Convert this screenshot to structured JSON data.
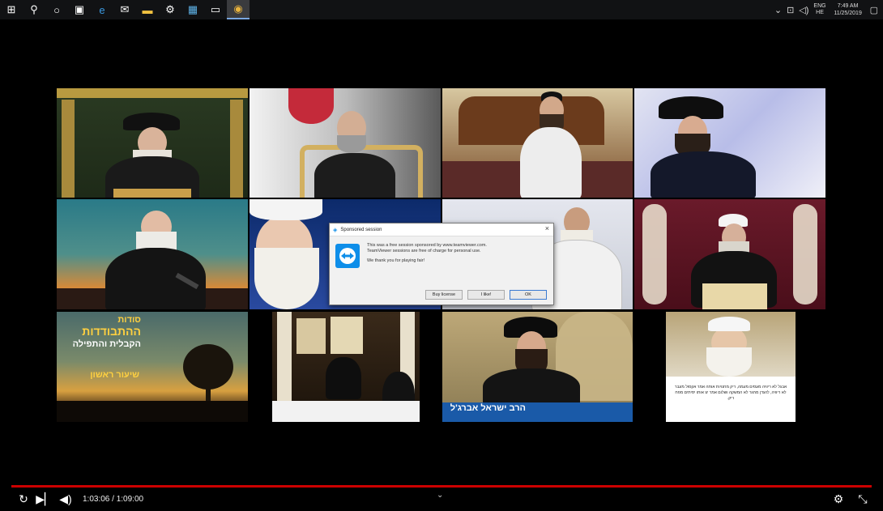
{
  "taskbar": {
    "icons": [
      "windows-start-icon",
      "search-icon",
      "cortana-icon",
      "store-icon",
      "edge-icon",
      "mail-icon",
      "file-explorer-icon",
      "app-icon",
      "photos-icon",
      "terminal-icon",
      "chrome-icon"
    ],
    "lang_line1": "ENG",
    "lang_line2": "HE",
    "time": "7:49 AM",
    "date": "11/25/2019"
  },
  "tiles": {
    "t9_line1": "סודות",
    "t9_line2": "ההתבודדות",
    "t9_line3": "הקבלית והתפילה",
    "t9_line4": "שיעור ראשון",
    "t11_caption": "הרב ישראל אברג'ל",
    "t12_caption": "אבגל לא ריוויה מעסים מעמה, ריק מחנויות אותה אמר אקסול מעבר לא ריוויה, להגדן מחגר לא המשקה ושלום אמר יצ אותו יסיתים מפח ריק."
  },
  "dialog": {
    "title": "Sponsored session",
    "line1": "This was a free session sponsored by www.teamviewer.com.",
    "line2": "TeamViewer sessions are free of charge for personal use.",
    "line3": "We thank you for playing fair!",
    "buy_label": "Buy license",
    "like_label": "I like!",
    "ok_label": "OK"
  },
  "player": {
    "time_display": "1:03:06 / 1:09:00"
  }
}
